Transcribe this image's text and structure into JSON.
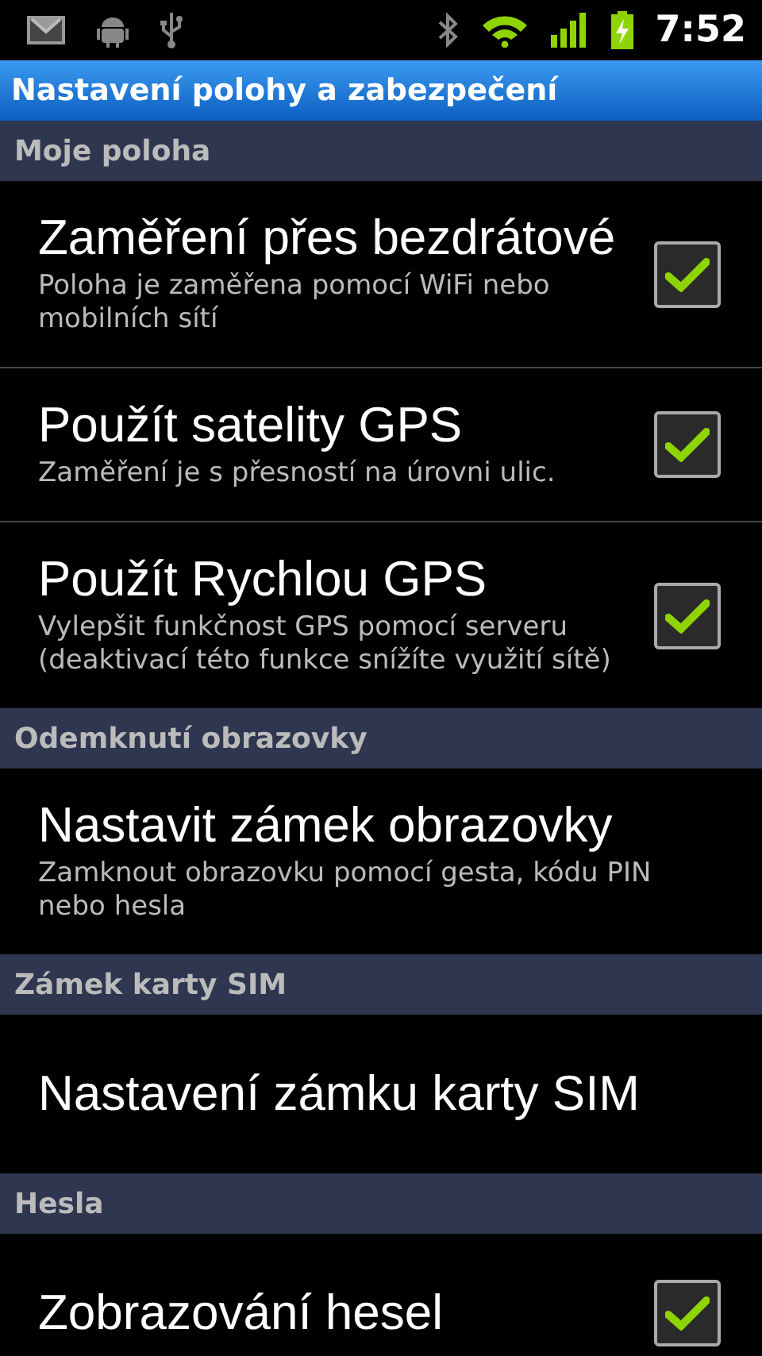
{
  "status_bar": {
    "time": "7:52"
  },
  "title": "Nastavení polohy a zabezpečení",
  "sections": [
    {
      "header": "Moje poloha",
      "items": [
        {
          "kind": "checkbox",
          "title": "Zaměření přes bezdrátové",
          "summary": "Poloha je zaměřena pomocí WiFi nebo mobilních sítí",
          "checked": true
        },
        {
          "kind": "checkbox",
          "title": "Použít satelity GPS",
          "summary": "Zaměření je s přesností na úrovni ulic.",
          "checked": true
        },
        {
          "kind": "checkbox",
          "title": "Použít Rychlou GPS",
          "summary": "Vylepšit funkčnost GPS pomocí serveru (deaktivací této funkce snížíte využití sítě)",
          "checked": true
        }
      ]
    },
    {
      "header": "Odemknutí obrazovky",
      "items": [
        {
          "kind": "plain",
          "title": "Nastavit zámek obrazovky",
          "summary": "Zamknout obrazovku pomocí gesta, kódu PIN nebo hesla"
        }
      ]
    },
    {
      "header": "Zámek karty SIM",
      "items": [
        {
          "kind": "plain",
          "title": "Nastavení zámku karty SIM"
        }
      ]
    },
    {
      "header": "Hesla",
      "items": [
        {
          "kind": "checkbox",
          "title": "Zobrazování hesel",
          "checked": true
        }
      ]
    }
  ]
}
